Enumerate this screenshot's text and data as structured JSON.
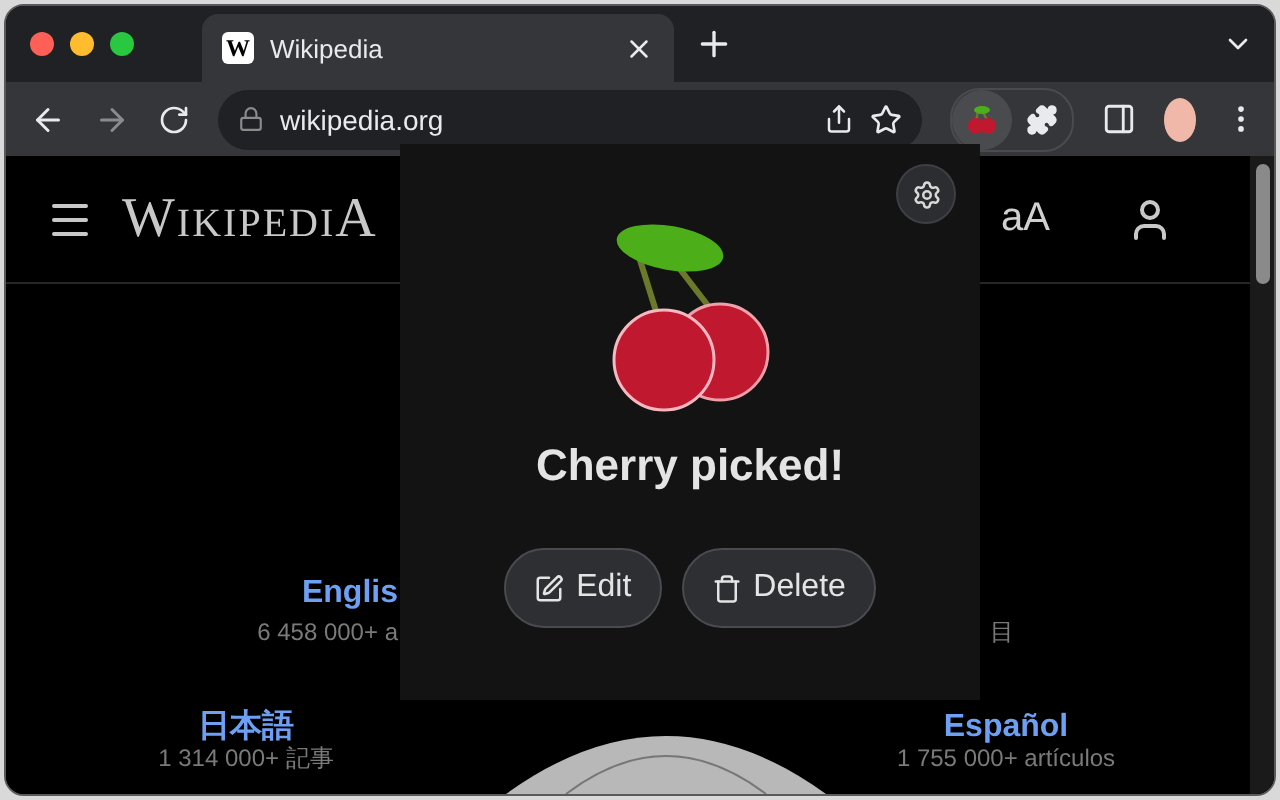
{
  "browser": {
    "tabs": [
      {
        "title": "Wikipedia",
        "favicon": "W",
        "selected": true
      }
    ],
    "address": "wikipedia.org"
  },
  "page": {
    "logo": "WikipediA",
    "text_size_label": "aA",
    "featured": [
      {
        "name": "Englis",
        "count": "6 458 000+ a"
      }
    ],
    "right_fragment": "目",
    "languages": [
      {
        "name": "日本語",
        "count": "1 314 000+ 記事"
      },
      {
        "name": "Español",
        "count": "1 755 000+ artículos"
      }
    ]
  },
  "popup": {
    "title": "Cherry picked!",
    "buttons": [
      {
        "label": "Edit",
        "kind": "edit"
      },
      {
        "label": "Delete",
        "kind": "delete"
      }
    ]
  }
}
